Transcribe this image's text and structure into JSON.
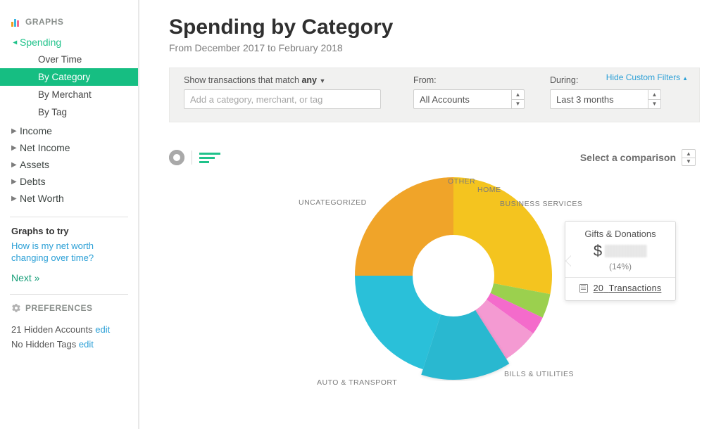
{
  "sidebar": {
    "graphs_header": "GRAPHS",
    "spending": {
      "label": "Spending",
      "children": [
        {
          "label": "Over Time"
        },
        {
          "label": "By Category",
          "active": true
        },
        {
          "label": "By Merchant"
        },
        {
          "label": "By Tag"
        }
      ]
    },
    "sections": [
      {
        "label": "Income"
      },
      {
        "label": "Net Income"
      },
      {
        "label": "Assets"
      },
      {
        "label": "Debts"
      },
      {
        "label": "Net Worth"
      }
    ],
    "graphs_to_try": {
      "heading": "Graphs to try",
      "link_text": "How is my net worth changing over time?",
      "next": "Next »"
    },
    "preferences_header": "PREFERENCES",
    "preferences": {
      "hidden_accounts": "21 Hidden Accounts",
      "hidden_accounts_edit": "edit",
      "hidden_tags": "No Hidden Tags",
      "hidden_tags_edit": "edit"
    }
  },
  "page": {
    "title": "Spending by Category",
    "date_range": "From December 2017 to February 2018"
  },
  "filters": {
    "match_label_prefix": "Show transactions that match",
    "match_mode": "any",
    "match_placeholder": "Add a category, merchant, or tag",
    "from_label": "From:",
    "from_value": "All Accounts",
    "during_label": "During:",
    "during_value": "Last 3 months",
    "hide_link": "Hide Custom Filters"
  },
  "toolbar": {
    "comparison_label": "Select a comparison"
  },
  "tooltip": {
    "category": "Gifts & Donations",
    "currency": "$",
    "percent": "(14%)",
    "transactions_count": 20,
    "transactions_label": "Transactions"
  },
  "chart_labels": {
    "uncategorized": "UNCATEGORIZED",
    "other": "OTHER",
    "home": "HOME",
    "business": "BUSINESS SERVICES",
    "bills": "BILLS & UTILITIES",
    "auto": "AUTO & TRANSPORT"
  },
  "chart_data": {
    "type": "pie",
    "title": "Spending by Category",
    "subtitle": "From December 2017 to February 2018",
    "donut": true,
    "series": [
      {
        "name": "Uncategorized",
        "percent": 28,
        "color": "#f4c41f"
      },
      {
        "name": "Other",
        "percent": 4,
        "color": "#9bd04e"
      },
      {
        "name": "Home",
        "percent": 3,
        "color": "#f46bcb"
      },
      {
        "name": "Business Services",
        "percent": 6,
        "color": "#f49ad2"
      },
      {
        "name": "Gifts & Donations",
        "percent": 14,
        "color": "#29b8d0",
        "highlighted": true,
        "transactions": 20
      },
      {
        "name": "Bills & Utilities",
        "percent": 20,
        "color": "#2ac0d9"
      },
      {
        "name": "Auto & Transport",
        "percent": 25,
        "color": "#f0a429"
      }
    ],
    "legend_position": "callout-labels"
  }
}
